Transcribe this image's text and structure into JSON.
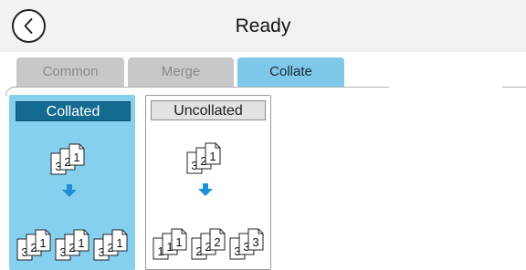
{
  "header": {
    "title": "Ready",
    "back_icon": "back-chevron-circle-icon"
  },
  "tabs": [
    {
      "label": "Common",
      "selected": false
    },
    {
      "label": "Merge",
      "selected": false
    },
    {
      "label": "Collate",
      "selected": true
    }
  ],
  "options": {
    "collated": {
      "label": "Collated",
      "selected": true,
      "input_pages": [
        "1",
        "2",
        "3"
      ],
      "output_sets": [
        [
          "1",
          "2",
          "3"
        ],
        [
          "1",
          "2",
          "3"
        ],
        [
          "1",
          "2",
          "3"
        ]
      ]
    },
    "uncollated": {
      "label": "Uncollated",
      "selected": false,
      "input_pages": [
        "1",
        "2",
        "3"
      ],
      "output_sets": [
        [
          "1",
          "1",
          "1"
        ],
        [
          "2",
          "2",
          "2"
        ],
        [
          "3",
          "3",
          "3"
        ]
      ]
    }
  },
  "colors": {
    "selected_tab": "#7ec8ea",
    "selected_card": "#86d0ef",
    "selected_label": "#136b8f",
    "arrow": "#1e8fd4"
  }
}
